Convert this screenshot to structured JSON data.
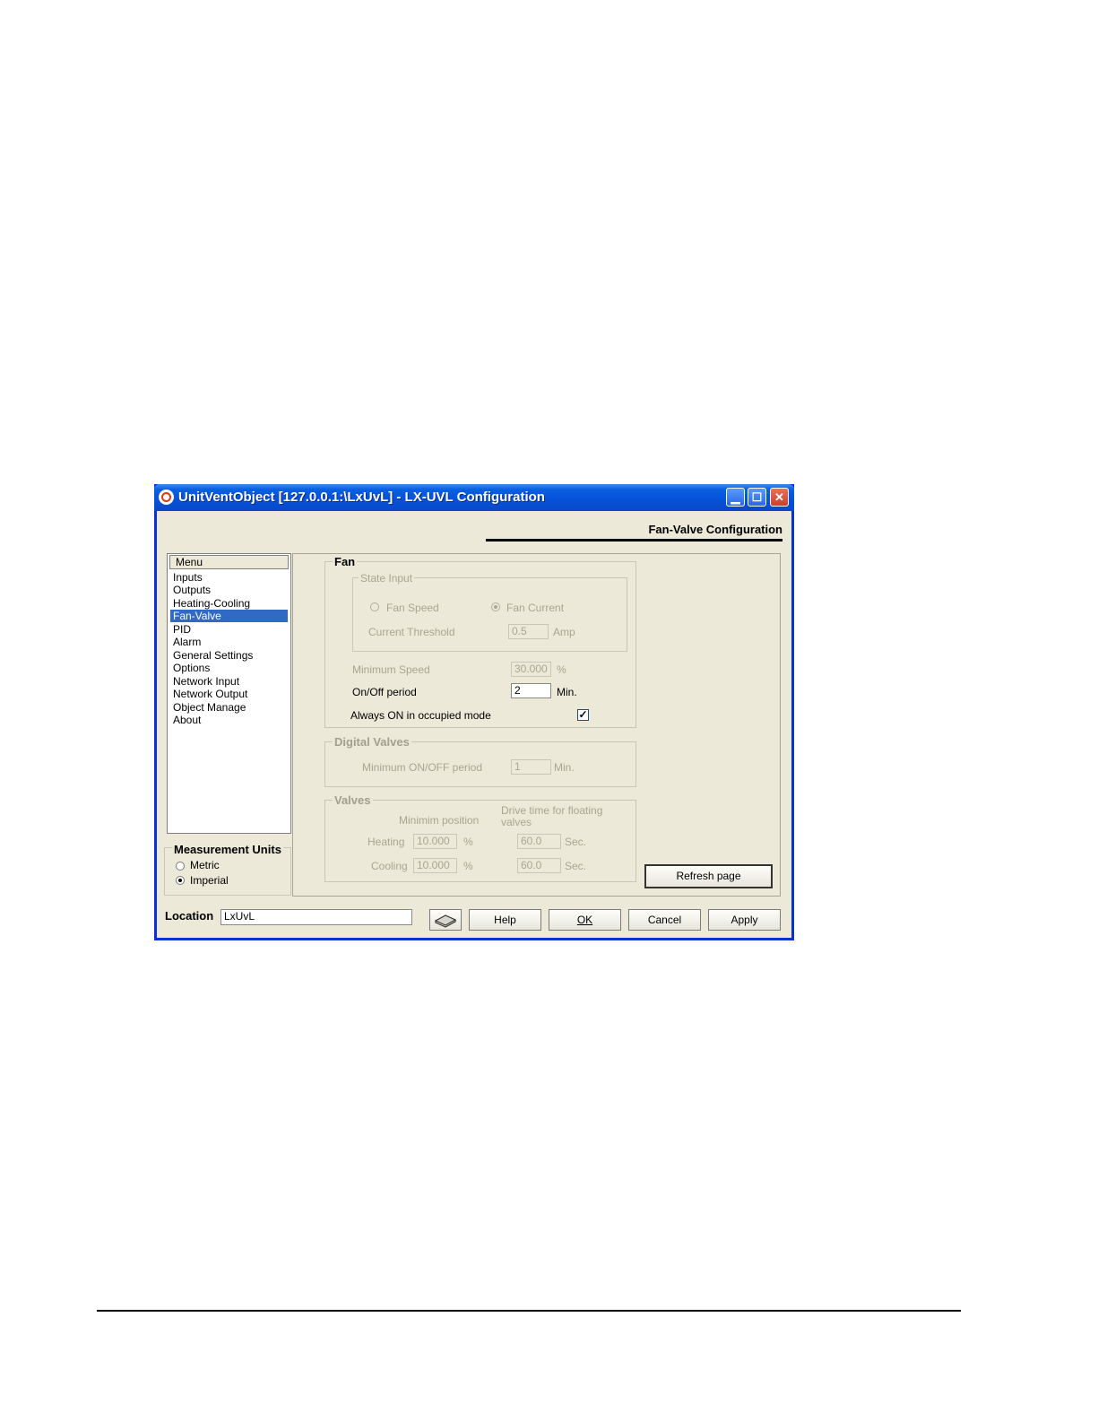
{
  "window": {
    "title": "UnitVentObject  [127.0.0.1:\\LxUvL] - LX-UVL Configuration",
    "minimize": "▁",
    "maximize": "☐",
    "close": "✕"
  },
  "header": {
    "page_title": "Fan-Valve Configuration"
  },
  "menu": {
    "header": "Menu",
    "items": [
      "Inputs",
      "Outputs",
      "Heating-Cooling",
      "Fan-Valve",
      "PID",
      "Alarm",
      "General Settings",
      "Options",
      "Network Input",
      "Network Output",
      "Object Manage",
      "About"
    ],
    "selected": "Fan-Valve"
  },
  "units": {
    "title": "Measurement Units",
    "metric": "Metric",
    "imperial": "Imperial",
    "selected": "Imperial"
  },
  "fan": {
    "title": "Fan",
    "state_input": {
      "title": "State Input",
      "fan_speed": "Fan Speed",
      "fan_current": "Fan Current",
      "selected": "Fan Current",
      "threshold_label": "Current Threshold",
      "threshold_value": "0.5",
      "threshold_unit": "Amp"
    },
    "min_speed_label": "Minimum Speed",
    "min_speed_value": "30.000",
    "min_speed_unit": "%",
    "onoff_label": "On/Off period",
    "onoff_value": "2",
    "onoff_unit": "Min.",
    "always_on_label": "Always ON in occupied mode",
    "always_on_checked": true,
    "check_mark": "✓"
  },
  "digital_valves": {
    "title": "Digital Valves",
    "min_label": "Minimum ON/OFF period",
    "min_value": "1",
    "min_unit": "Min."
  },
  "valves": {
    "title": "Valves",
    "col_min": "Minimim position",
    "col_drive": "Drive time for floating valves",
    "heating_label": "Heating",
    "heating_min": "10.000",
    "heating_drive": "60.0",
    "cooling_label": "Cooling",
    "cooling_min": "10.000",
    "cooling_drive": "60.0",
    "pct": "%",
    "sec": "Sec."
  },
  "refresh_button": "Refresh page",
  "footer": {
    "location_label": "Location",
    "location_value": "LxUvL",
    "help": "Help",
    "ok": "OK",
    "cancel": "Cancel",
    "apply": "Apply"
  }
}
